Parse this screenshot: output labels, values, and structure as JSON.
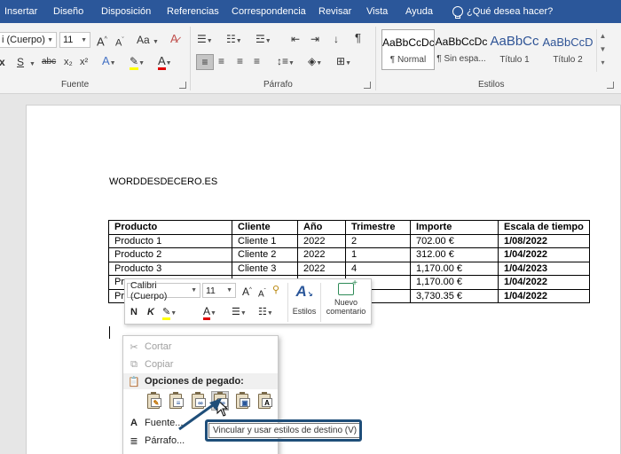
{
  "menu": {
    "items": [
      "Insertar",
      "Diseño",
      "Disposición",
      "Referencias",
      "Correspondencia",
      "Revisar",
      "Vista",
      "Ayuda"
    ],
    "search_label": "¿Qué desea hacer?"
  },
  "ribbon": {
    "font": {
      "font_name": "i (Cuerpo)",
      "font_size": "11",
      "grow_label": "A",
      "shrink_label": "A",
      "case_label": "Aa",
      "bold": "N",
      "italic": "K",
      "underline": "S",
      "strike": "abc",
      "subscript": "x₂",
      "superscript": "x²",
      "effects": "A",
      "font_color": "A",
      "group_label": "Fuente"
    },
    "paragraph": {
      "pilcrow": "¶",
      "group_label": "Párrafo"
    },
    "styles": {
      "items": [
        {
          "sample": "AaBbCcDc",
          "name": "¶ Normal"
        },
        {
          "sample": "AaBbCcDc",
          "name": "¶ Sin espa..."
        },
        {
          "sample": "AaBbCc",
          "name": "Título 1"
        },
        {
          "sample": "AaBbCcD",
          "name": "Título 2"
        }
      ],
      "group_label": "Estilos"
    }
  },
  "document": {
    "title": "WORDDESDECERO.ES",
    "table": {
      "headers": [
        "Producto",
        "Cliente",
        "Año",
        "Trimestre",
        "Importe",
        "Escala de tiempo"
      ],
      "rows": [
        [
          "Producto 1",
          "Cliente 1",
          "2022",
          "2",
          "702.00 €",
          "1/08/2022"
        ],
        [
          "Producto 2",
          "Cliente 2",
          "2022",
          "1",
          "312.00 €",
          "1/04/2022"
        ],
        [
          "Producto 3",
          "Cliente 3",
          "2022",
          "4",
          "1,170.00 €",
          "1/04/2023"
        ],
        [
          "Pr",
          "",
          "",
          "",
          "1,170.00 €",
          "1/04/2022"
        ],
        [
          "Pr",
          "",
          "",
          "",
          "3,730.35 €",
          "1/04/2022"
        ]
      ]
    }
  },
  "mini_toolbar": {
    "font_name": "Calibri (Cuerpo)",
    "font_size": "11",
    "bold": "N",
    "italic": "K",
    "styles_label": "Estilos",
    "new_comment_line1": "Nuevo",
    "new_comment_line2": "comentario"
  },
  "context_menu": {
    "cut": "Cortar",
    "copy": "Copiar",
    "paste_header": "Opciones de pegado:",
    "font": "Fuente...",
    "paragraph": "Párrafo..."
  },
  "tooltip": "Vincular y usar estilos de destino (V)"
}
